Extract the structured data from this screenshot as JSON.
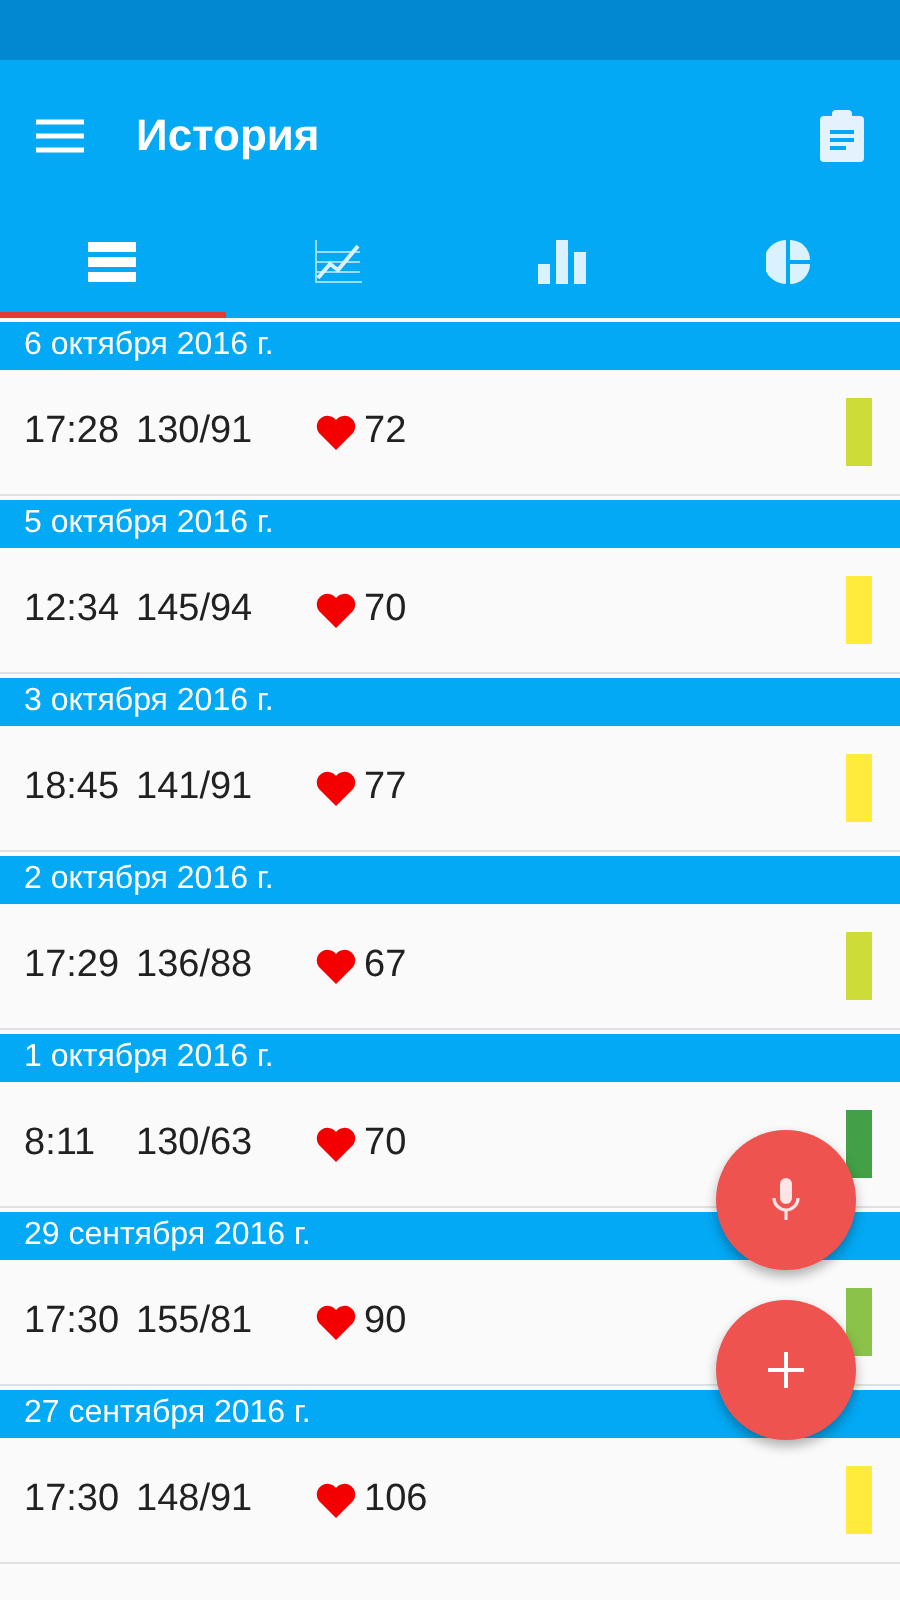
{
  "toolbar": {
    "title": "История"
  },
  "tabs": [
    {
      "kind": "list",
      "selected": true
    },
    {
      "kind": "line",
      "selected": false
    },
    {
      "kind": "bar",
      "selected": false
    },
    {
      "kind": "pie",
      "selected": false
    }
  ],
  "days": [
    {
      "date": "6 октября 2016 г.",
      "entries": [
        {
          "time": "17:28",
          "pressure": "130/91",
          "pulse": "72",
          "color": "#cddc39"
        }
      ]
    },
    {
      "date": "5 октября 2016 г.",
      "entries": [
        {
          "time": "12:34",
          "pressure": "145/94",
          "pulse": "70",
          "color": "#ffeb3b"
        }
      ]
    },
    {
      "date": "3 октября 2016 г.",
      "entries": [
        {
          "time": "18:45",
          "pressure": "141/91",
          "pulse": "77",
          "color": "#ffeb3b"
        }
      ]
    },
    {
      "date": "2 октября 2016 г.",
      "entries": [
        {
          "time": "17:29",
          "pressure": "136/88",
          "pulse": "67",
          "color": "#cddc39"
        }
      ]
    },
    {
      "date": "1 октября 2016 г.",
      "entries": [
        {
          "time": "8:11",
          "pressure": "130/63",
          "pulse": "70",
          "color": "#43a047"
        }
      ]
    },
    {
      "date": "29 сентября 2016 г.",
      "entries": [
        {
          "time": "17:30",
          "pressure": "155/81",
          "pulse": "90",
          "color": "#8bc34a"
        }
      ]
    },
    {
      "date": "27 сентября 2016 г.",
      "entries": [
        {
          "time": "17:30",
          "pressure": "148/91",
          "pulse": "106",
          "color": "#ffeb3b"
        }
      ]
    }
  ],
  "fabs": [
    {
      "kind": "mic"
    },
    {
      "kind": "add"
    }
  ]
}
